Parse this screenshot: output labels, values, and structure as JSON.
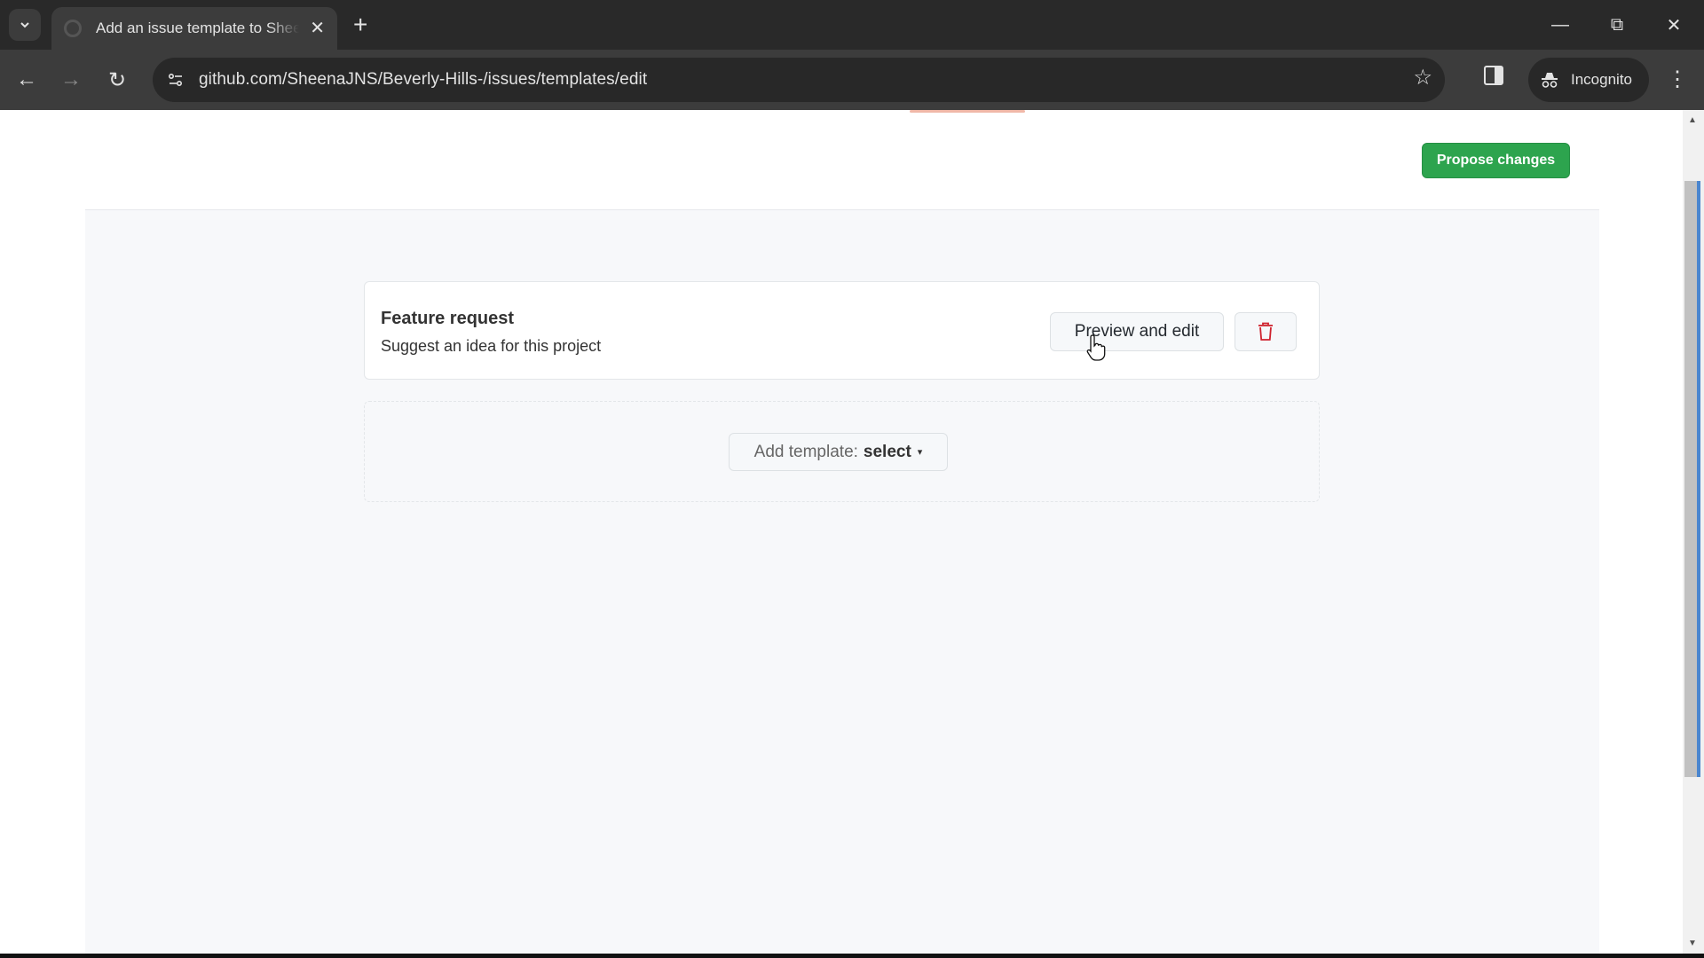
{
  "browser": {
    "tab_search_icon": "chevron-down-icon",
    "tab": {
      "title": "Add an issue template to SheenaJNS/Beverly-Hills-",
      "favicon": "github-icon",
      "close_label": "✕"
    },
    "new_tab_label": "+",
    "window_controls": {
      "minimize": "—",
      "restore": "⧉",
      "close": "✕"
    },
    "nav": {
      "back": "←",
      "forward": "→",
      "reload": "↻"
    },
    "site_info_icon": "tune-icon",
    "url": "github.com/SheenaJNS/Beverly-Hills-/issues/templates/edit",
    "bookmark_icon": "☆",
    "incognito_label": "Incognito",
    "menu_icon": "⋮"
  },
  "page": {
    "propose_changes_label": "Propose changes",
    "accent_color": "#2da44e",
    "templates": [
      {
        "name": "Feature request",
        "description": "Suggest an idea for this project",
        "preview_label": "Preview and edit",
        "delete_icon": "trash-icon"
      }
    ],
    "add_template": {
      "label": "Add template:",
      "value": "select",
      "caret": "▾"
    }
  },
  "scrollbar": {
    "up": "▲",
    "down": "▼"
  }
}
